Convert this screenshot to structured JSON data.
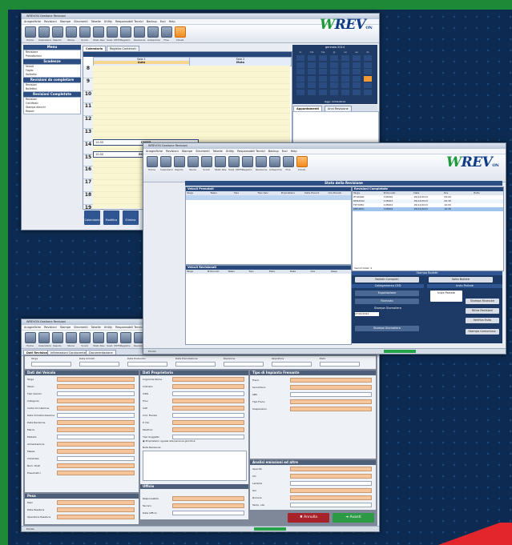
{
  "app": {
    "brand_prefix": "W",
    "brand_main": "REV",
    "brand_suffix": "ON",
    "window_title": "WREVON Gestione Revisioni",
    "menus": [
      "Anagrafiche",
      "Revisioni",
      "Stampe",
      "Strumenti",
      "Tabelle",
      "Utility",
      "Responsabili Tecnici",
      "Backup",
      "Esci",
      "Help"
    ],
    "toolbar": [
      "Home",
      "Calendario",
      "Rapido",
      "Storie",
      "Scadi",
      "Stato Rev.",
      "Scad. MCTC",
      "Registro",
      "Revisione",
      "Anteprime",
      "Fine",
      "Chiudi"
    ]
  },
  "win1": {
    "tabs": [
      "Calendario",
      "Registro Contenuti"
    ],
    "side_sections": [
      {
        "title": "Menu",
        "items": [
          "Revisione",
          "Prenotazioni"
        ]
      },
      {
        "title": "Scadenze",
        "items": [
          "Veicoli",
          "Foglio",
          "Sollecito"
        ]
      },
      {
        "title": "Revisioni da completare",
        "items": [
          "Revisioni",
          "Bollettini"
        ]
      },
      {
        "title": "Revisioni Completate",
        "items": [
          "Revisioni",
          "Certificati",
          "Stampa elenchi",
          "Report"
        ]
      }
    ],
    "col_headers": [
      "Sala 1",
      "Sala 2"
    ],
    "col_sub": [
      "Auto",
      "Moto"
    ],
    "hours": [
      "8",
      "9",
      "10",
      "11",
      "12",
      "13",
      "14",
      "15",
      "16",
      "17",
      "18",
      "19"
    ],
    "appointments": [
      {
        "hour": "14",
        "plate": "CB885",
        "time": "14:00"
      },
      {
        "hour": "15",
        "plate": "RG8562T",
        "time": "15:00"
      }
    ],
    "calendar_title": "gennaio 2014",
    "calendar_days": [
      "lu",
      "ma",
      "me",
      "gi",
      "ve",
      "sa",
      "do"
    ],
    "calendar_footer": "Oggi: 27/01/2014",
    "right_tabs": [
      "Appuntamenti",
      "Anni Revisione"
    ],
    "bottom_buttons": [
      "Calendario",
      "Modifica",
      "Elimina"
    ]
  },
  "win2": {
    "title": "Stato della Revisione",
    "panel_left_title": "Veicoli Prenotati",
    "panel_left_cols": [
      "Targa",
      "Telaio",
      "Tipo",
      "Tipo Veic.",
      "Proprietario",
      "Data Prenot.",
      "Ora Prenot."
    ],
    "panel_bottom_title": "Veicoli Revisionati",
    "panel_bottom_cols": [
      "Targa",
      "Protocollo",
      "Telaio",
      "Tipo",
      "Esito",
      "Data",
      "Ora",
      "Resp."
    ],
    "panel_right_title": "Revisioni Completate",
    "panel_right_cols": [
      "Targa",
      "Protocollo",
      "Data",
      "Ora",
      "Esito"
    ],
    "right_rows": [
      [
        "ZT40000",
        "145000",
        "26/12/2013",
        "09:00"
      ],
      [
        "RD62002",
        "145002",
        "26/12/2013",
        "09:30"
      ],
      [
        "FZ70050",
        "145004",
        "26/12/2013",
        "10:00"
      ],
      [
        "DB04801",
        "145006",
        "26/12/2013",
        "10:30"
      ]
    ],
    "footer_status": "Veicoli totali: 4",
    "stampe_title": "Stampa Bolletti",
    "stampe_buttons": [
      "Bolletti Completi",
      "Salta Bolletti"
    ],
    "collegamento_title": "Collegamento CED",
    "collegamento_buttons": [
      "Esportazione",
      "Ricevuto"
    ],
    "stampa_foglio_title": "Stampa Foglio",
    "invio_title": "Invio Portale",
    "invio_buttons": [
      "Invia Portale",
      "Stampa Ricevute",
      "Ritira Revisioni",
      "Verifica Esito"
    ],
    "stampa_giornaliera_title": "Stampa Giornaliera",
    "stampa_giornaliera_date": "27/01/2014",
    "stampa_giornaliera_button": "Stampa Giornaliera",
    "stampa_comunicazione": "Stampa Comunicaz.",
    "status_text": "Pronto"
  },
  "win3": {
    "tabs": [
      "Dati Revisione",
      "Informazioni Conducente",
      "Documentazione"
    ],
    "header_fields": [
      "Targa",
      "Data Immatr.",
      "Data Protocollo",
      "Data Prenotazione",
      "Revisione",
      "Operatore",
      "Esito"
    ],
    "sect_veicolo": "Dati del Veicolo",
    "veicolo_labels": [
      "Targa",
      "Telaio",
      "Tipo Veicolo",
      "Categoria",
      "Carta Circolazione",
      "Data Immatricolazione",
      "Data Revisione",
      "Marca",
      "Modello",
      "Alimentazione",
      "Massa",
      "Cilindrata",
      "Num. Posti",
      "Pneumatici"
    ],
    "sect_proprietario": "Dati Proprietario",
    "proprietario_labels": [
      "Cognome Nome",
      "Indirizzo",
      "Città",
      "Prov.",
      "CAP",
      "Cod. Fiscale",
      "P. IVA",
      "Telefono",
      "Tipo Soggetto"
    ],
    "radio_label": "Proprietario uguale alla persona giuridica",
    "note_label": "Note Revisione",
    "sect_impianto": "Tipo di Impianto Frenante",
    "impianto_labels": [
      "Freno",
      "Servofreno",
      "ABS",
      "Tipo Freno",
      "Sospensioni"
    ],
    "sect_analisi": "Analisi emissioni ed altre",
    "analisi_labels": [
      "Opacità",
      "CO",
      "Lambda",
      "Giri",
      "Rumore",
      "Temp. olio"
    ],
    "sect_pesa": "Pesa",
    "pesa_labels": [
      "Peso",
      "Data Pesatura",
      "Operatore Pesatura"
    ],
    "sect_ufficio": "Ufficio",
    "ufficio_labels": [
      "Responsabile",
      "Tecnico",
      "Data Ufficio"
    ],
    "btn_annulla": "Annulla",
    "btn_avanti": "Avanti",
    "status_text": "Pronto"
  }
}
